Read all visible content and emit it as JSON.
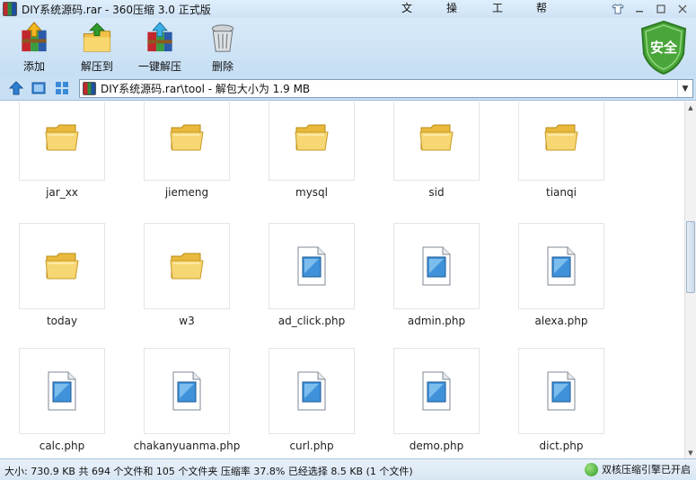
{
  "window": {
    "title": "DIY系统源码.rar - 360压缩 3.0 正式版",
    "menu": [
      "文件",
      "操作",
      "工具",
      "帮助"
    ]
  },
  "toolbar": {
    "add_label": "添加",
    "extract_to_label": "解压到",
    "one_click_label": "一键解压",
    "delete_label": "删除"
  },
  "security_badge": {
    "label": "安全",
    "color": "#4aa63a"
  },
  "address": {
    "path": "DIY系统源码.rar\\tool - 解包大小为 1.9 MB"
  },
  "files": [
    {
      "name": "jar_xx",
      "type": "folder"
    },
    {
      "name": "jiemeng",
      "type": "folder"
    },
    {
      "name": "mysql",
      "type": "folder"
    },
    {
      "name": "sid",
      "type": "folder"
    },
    {
      "name": "tianqi",
      "type": "folder"
    },
    {
      "name": "today",
      "type": "folder"
    },
    {
      "name": "w3",
      "type": "folder"
    },
    {
      "name": "ad_click.php",
      "type": "file"
    },
    {
      "name": "admin.php",
      "type": "file"
    },
    {
      "name": "alexa.php",
      "type": "file"
    },
    {
      "name": "calc.php",
      "type": "file"
    },
    {
      "name": "chakanyuanma.php",
      "type": "file"
    },
    {
      "name": "curl.php",
      "type": "file"
    },
    {
      "name": "demo.php",
      "type": "file"
    },
    {
      "name": "dict.php",
      "type": "file"
    }
  ],
  "status": {
    "summary": "大小: 730.9 KB 共 694 个文件和 105 个文件夹 压缩率 37.8% 已经选择 8.5 KB (1 个文件)",
    "engine": "双核压缩引擎已开启"
  },
  "colors": {
    "toolbar_bg": "#c6def3",
    "title_bg": "#dfeefb",
    "folder": "#f3d36b"
  }
}
